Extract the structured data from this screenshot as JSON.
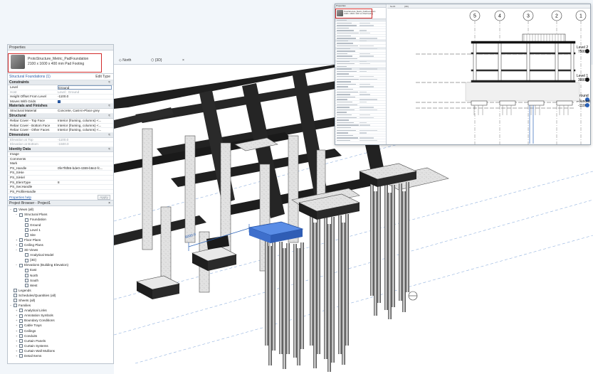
{
  "properties": {
    "title": "Properties",
    "type_name": "ProtoStructure_Metric_PadFoundation",
    "type_size": "2100 x 1600 x 400 mm Pad Footing",
    "filter_label": "Structural Foundations (1)",
    "edit_type": "Edit Type",
    "groups": {
      "constraints": "Constraints",
      "materials": "Materials and Finishes",
      "structural": "Structural",
      "dimensions": "Dimensions",
      "identity": "Identity Data"
    },
    "rows": {
      "level_k": "Level",
      "level_v": "Ground",
      "host_k": "Host",
      "host_v": "Level : Ground",
      "offset_k": "Height Offset From Level",
      "offset_v": "-1100.0",
      "moves_k": "Moves With Grids",
      "material_k": "Structural Material",
      "material_v": "Concrete, Cast-in-Place grey",
      "rebar_top_k": "Rebar Cover - Top Face",
      "rebar_top_v": "Interior (framing, columns) <...",
      "rebar_bottom_k": "Rebar Cover - Bottom Face",
      "rebar_bottom_v": "Interior (framing, columns) <...",
      "rebar_other_k": "Rebar Cover - Other Faces",
      "rebar_other_v": "Interior (framing, columns) <...",
      "elev_top_k": "Elevation at Top",
      "elev_top_v": "-1100.0",
      "elev_bottom_k": "Elevation at Bottom",
      "elev_bottom_v": "-1500.0",
      "image_k": "Image",
      "comments_k": "Comments",
      "mark_k": "Mark",
      "handle_k": "PS_Handle",
      "handle_v": "0fe7f6f86-bde0-4389-b8e2-fc...",
      "sihie_k": "PS_SiHie",
      "sihiel_k": "PS_SiHiel",
      "elemtype_k": "PS_ElemType",
      "elemtype_v": "8",
      "sechandle_k": "PS_SecHandle",
      "profhandle_k": "PS_ProfileHandle"
    },
    "help_link": "Properties help",
    "apply_label": "Apply"
  },
  "browser": {
    "title": "Project Browser - Project1",
    "close": "×",
    "nodes": [
      {
        "label": "Views (all)",
        "indent": 0,
        "toggle": "−"
      },
      {
        "label": "Structural Plans",
        "indent": 1,
        "toggle": "−"
      },
      {
        "label": "Foundation",
        "indent": 2,
        "toggle": ""
      },
      {
        "label": "Ground",
        "indent": 2,
        "toggle": ""
      },
      {
        "label": "Level 1",
        "indent": 2,
        "toggle": ""
      },
      {
        "label": "Site",
        "indent": 2,
        "toggle": ""
      },
      {
        "label": "Floor Plans",
        "indent": 1,
        "toggle": "+"
      },
      {
        "label": "Ceiling Plans",
        "indent": 1,
        "toggle": "+"
      },
      {
        "label": "3D Views",
        "indent": 1,
        "toggle": "−"
      },
      {
        "label": "Analytical Model",
        "indent": 2,
        "toggle": ""
      },
      {
        "label": "{3D}",
        "indent": 2,
        "toggle": ""
      },
      {
        "label": "Elevations (Building Elevation)",
        "indent": 1,
        "toggle": "−"
      },
      {
        "label": "East",
        "indent": 2,
        "toggle": ""
      },
      {
        "label": "North",
        "indent": 2,
        "toggle": ""
      },
      {
        "label": "South",
        "indent": 2,
        "toggle": ""
      },
      {
        "label": "West",
        "indent": 2,
        "toggle": ""
      },
      {
        "label": "Legends",
        "indent": 0,
        "toggle": ""
      },
      {
        "label": "Schedules/Quantities (all)",
        "indent": 0,
        "toggle": ""
      },
      {
        "label": "Sheets (all)",
        "indent": 0,
        "toggle": ""
      },
      {
        "label": "Families",
        "indent": 0,
        "toggle": "−"
      },
      {
        "label": "Analytical Links",
        "indent": 1,
        "toggle": "+"
      },
      {
        "label": "Annotation Symbols",
        "indent": 1,
        "toggle": "+"
      },
      {
        "label": "Boundary Conditions",
        "indent": 1,
        "toggle": "+"
      },
      {
        "label": "Cable Trays",
        "indent": 1,
        "toggle": "+"
      },
      {
        "label": "Ceilings",
        "indent": 1,
        "toggle": "+"
      },
      {
        "label": "Conduits",
        "indent": 1,
        "toggle": "+"
      },
      {
        "label": "Curtain Panels",
        "indent": 1,
        "toggle": "+"
      },
      {
        "label": "Curtain Systems",
        "indent": 1,
        "toggle": "+"
      },
      {
        "label": "Curtain Wall Mullions",
        "indent": 1,
        "toggle": "+"
      },
      {
        "label": "Detail Items",
        "indent": 1,
        "toggle": "+"
      }
    ]
  },
  "tabs": {
    "north": "North",
    "three_d": "{3D}",
    "close": "×"
  },
  "viewport": {
    "dimension": "6000.0"
  },
  "inset": {
    "tab_left": "Properties",
    "tab_a": "North",
    "tab_b": "{3D}",
    "grids": [
      "5",
      "4",
      "3",
      "2",
      "1"
    ],
    "levels": [
      {
        "name": "Level 2",
        "value": "7500"
      },
      {
        "name": "Level 1",
        "value": "3000"
      },
      {
        "name": "Ground",
        "value": "0"
      },
      {
        "name": "Foundation",
        "value": "-1100"
      }
    ]
  },
  "colors": {
    "accent": "#2b62b8",
    "highlight": "#d22b2b",
    "selection": "#4a82e0",
    "concrete_dark": "#2a2a2a",
    "concrete_light": "#e4e4e4"
  }
}
